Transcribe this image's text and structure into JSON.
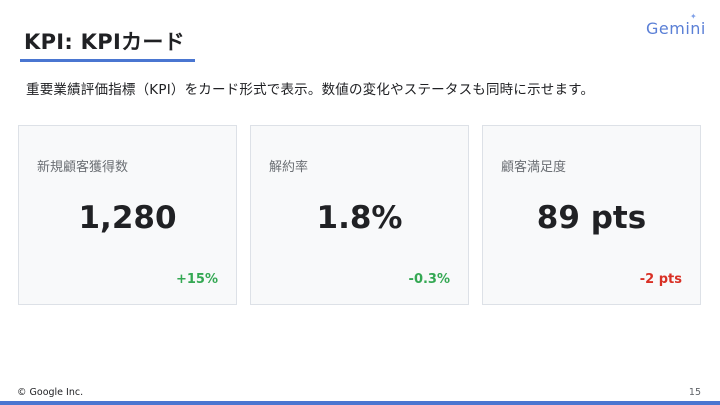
{
  "slide": {
    "title": "KPI: KPIカード",
    "subtitle": "重要業績評価指標（KPI）をカード形式で表示。数値の変化やステータスも同時に示せます。",
    "logo_text": "Gemini",
    "footer": "© Google Inc.",
    "page_number": "15"
  },
  "cards": [
    {
      "label": "新規顧客獲得数",
      "value": "1,280",
      "change": "+15%",
      "change_color": "#34a853"
    },
    {
      "label": "解約率",
      "value": "1.8%",
      "change": "-0.3%",
      "change_color": "#34a853"
    },
    {
      "label": "顧客満足度",
      "value": "89 pts",
      "change": "-2 pts",
      "change_color": "#d93025"
    }
  ],
  "colors": {
    "accent": "#4a76d1",
    "positive": "#34a853",
    "negative": "#d93025"
  }
}
